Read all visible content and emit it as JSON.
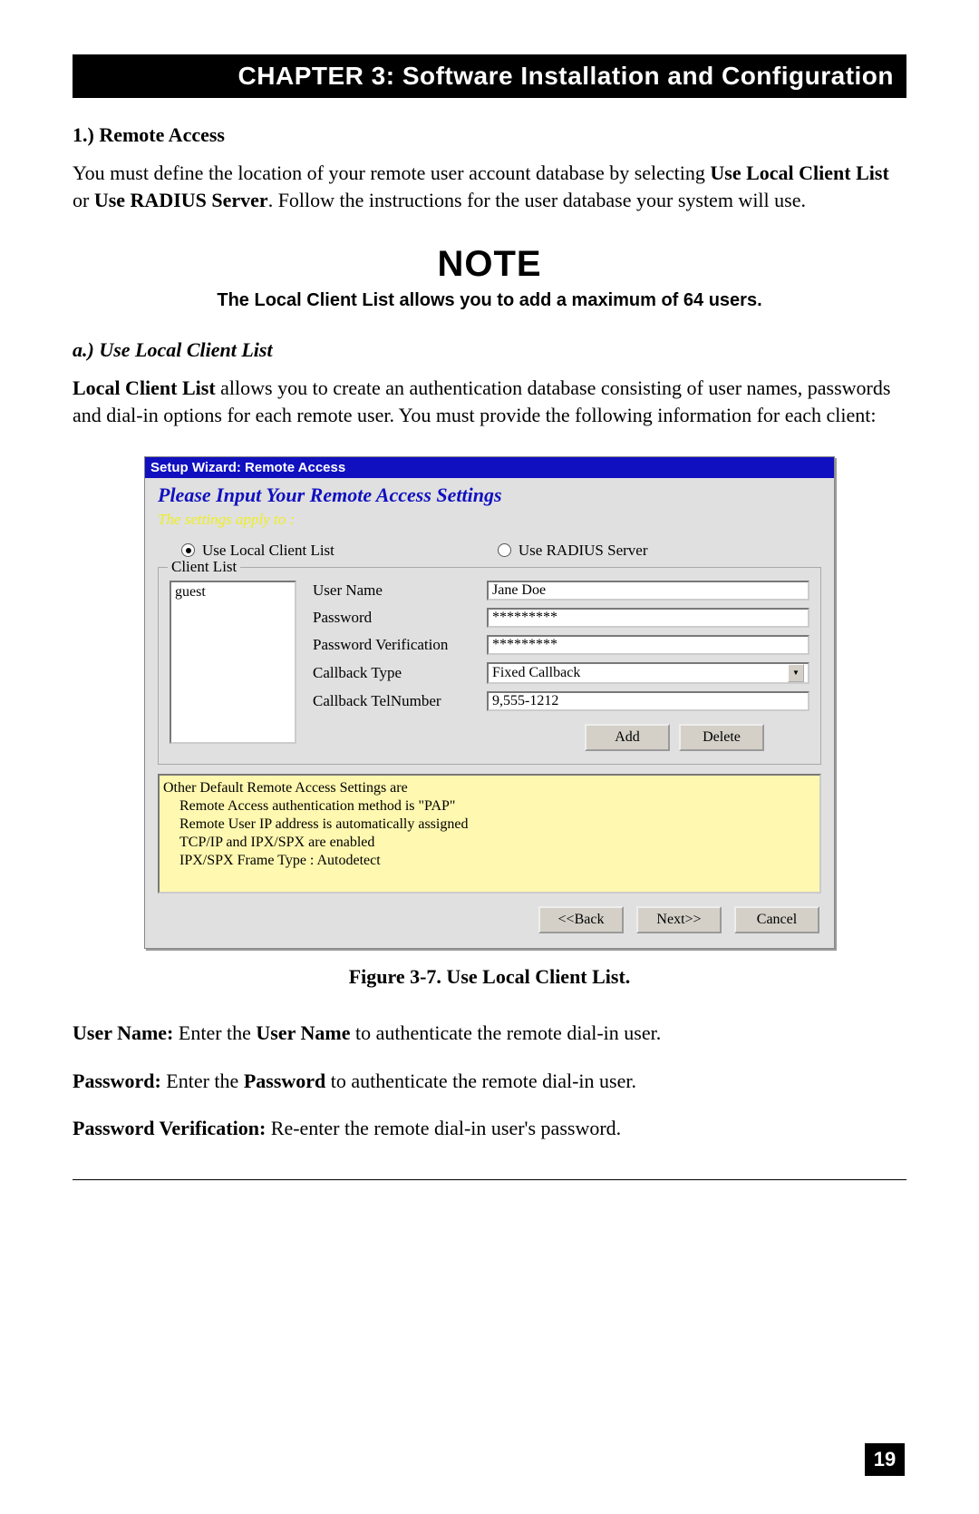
{
  "chapter_banner": "CHAPTER 3: Software Installation and Configuration",
  "sec1_heading": "1.) Remote Access",
  "p1_a": "You must define the location of your remote user account database by selecting ",
  "p1_b": "Use Local Client List",
  "p1_c": " or ",
  "p1_d": "Use RADIUS Server",
  "p1_e": ".  Follow the instructions for the user database your system will use.",
  "note_heading": "NOTE",
  "note_text": "The Local Client List allows you to add a maximum of 64 users.",
  "sub_a": "a.) Use Local Client List",
  "p2_a": "Local Client List",
  "p2_b": " allows you to create an authentication database consisting of user names, passwords and dial-in options for each remote user.  You must provide the following information for each client:",
  "wizard": {
    "titlebar": "Setup Wizard: Remote Access",
    "heading": "Please Input Your Remote Access Settings",
    "apply_line": "The settings apply to :",
    "radio_local": "Use Local Client List",
    "radio_radius": "Use RADIUS Server",
    "fieldset_legend": "Client List",
    "list_item": "guest",
    "labels": {
      "username": "User Name",
      "password": "Password",
      "pwd_verify": "Password Verification",
      "callback_type": "Callback Type",
      "callback_tel": "Callback TelNumber"
    },
    "values": {
      "username": "Jane Doe",
      "password": "*********",
      "pwd_verify": "*********",
      "callback_type": "Fixed Callback",
      "callback_tel": "9,555-1212"
    },
    "buttons": {
      "add": "Add",
      "delete": "Delete",
      "back": "<<Back",
      "next": "Next>>",
      "cancel": "Cancel"
    },
    "info": {
      "l1": "Other Default Remote Access Settings are",
      "l2": "Remote Access authentication method is \"PAP\"",
      "l3": "Remote User IP address is automatically assigned",
      "l4": "TCP/IP and IPX/SPX are enabled",
      "l5": "IPX/SPX Frame Type : Autodetect"
    }
  },
  "figcaption": "Figure 3-7. Use Local Client List.",
  "def_user_a": "User Name:",
  "def_user_b": " Enter the ",
  "def_user_c": "User Name",
  "def_user_d": " to authenticate the remote dial-in user.",
  "def_pwd_a": "Password:",
  "def_pwd_b": " Enter the ",
  "def_pwd_c": "Password",
  "def_pwd_d": " to authenticate the remote dial-in user.",
  "def_pv_a": "Password Verification:",
  "def_pv_b": "  Re-enter the remote dial-in user's password.",
  "page_number": "19"
}
